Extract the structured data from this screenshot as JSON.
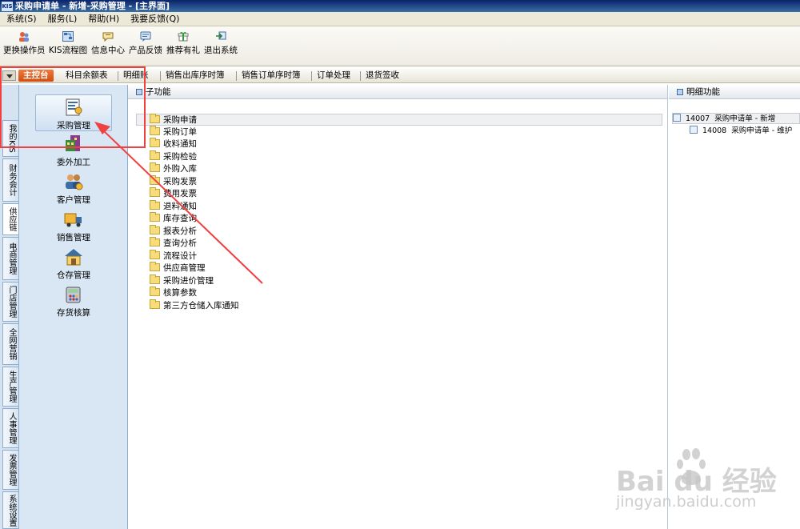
{
  "window": {
    "title": "采购申请单 - 新增-采购管理 - [主界面]",
    "logo": "KIS"
  },
  "menubar": [
    "系统(S)",
    "服务(L)",
    "帮助(H)",
    "我要反馈(Q)"
  ],
  "toolbar": [
    {
      "label": "更换操作员",
      "icon": "switch-user-icon"
    },
    {
      "label": "KIS流程图",
      "icon": "flowchart-icon"
    },
    {
      "label": "信息中心",
      "icon": "message-icon"
    },
    {
      "label": "产品反馈",
      "icon": "feedback-icon"
    },
    {
      "label": "推荐有礼",
      "icon": "gift-icon"
    },
    {
      "label": "退出系统",
      "icon": "exit-icon"
    }
  ],
  "navtabs": [
    "主控台",
    "科目余额表",
    "明细账",
    "销售出库序时簿",
    "销售订单序时簿",
    "订单处理",
    "退货签收"
  ],
  "vtabs": [
    "我的KIS",
    "财务会计",
    "供应链",
    "电商管理",
    "门店管理",
    "全网营销",
    "生产管理",
    "人事管理",
    "发票管理",
    "系统设置"
  ],
  "modules": [
    "采购管理",
    "委外加工",
    "客户管理",
    "销售管理",
    "仓存管理",
    "存货核算"
  ],
  "subpanel": {
    "title": "子功能",
    "folders": [
      "采购申请",
      "采购订单",
      "收料通知",
      "采购检验",
      "外购入库",
      "采购发票",
      "费用发票",
      "退料通知",
      "库存查询",
      "报表分析",
      "查询分析",
      "流程设计",
      "供应商管理",
      "采购进价管理",
      "核算参数",
      "第三方仓储入库通知"
    ]
  },
  "detail": {
    "title": "明细功能",
    "items": [
      {
        "code": "14007",
        "name": "采购申请单 - 新增"
      },
      {
        "code": "14008",
        "name": "采购申请单 - 维护"
      }
    ]
  },
  "watermark": {
    "brand": "Bai du 经验",
    "url": "jingyan.baidu.com"
  },
  "colors": {
    "accent": "#d24c10",
    "annotation": "#f04040",
    "titlebar": "#0a246a"
  }
}
